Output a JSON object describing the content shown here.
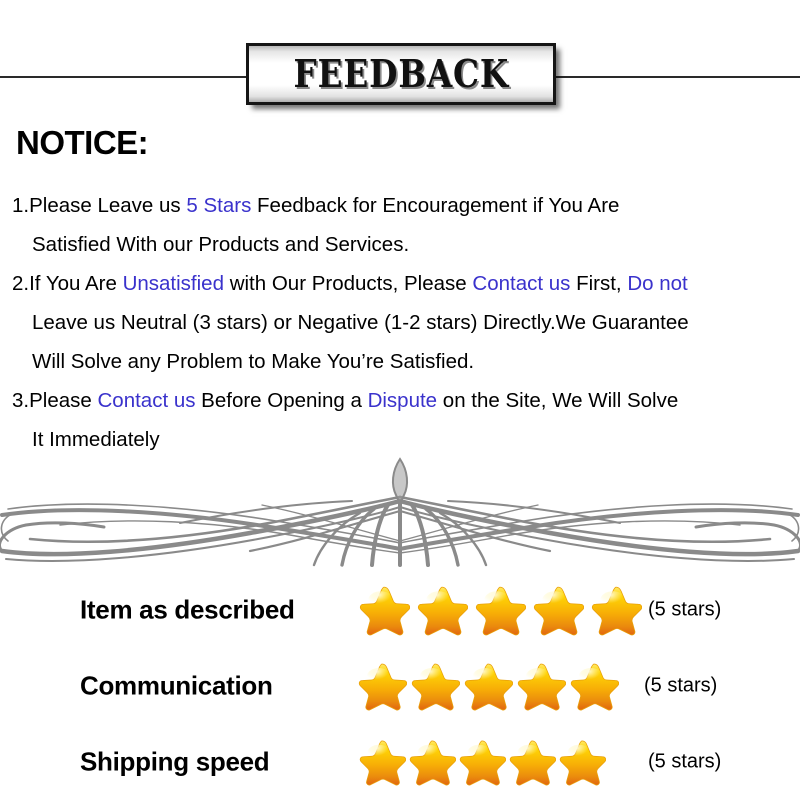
{
  "banner": {
    "title": "FEEDBACK"
  },
  "notice": {
    "heading": "NOTICE:",
    "items": [
      {
        "lines": [
          [
            {
              "t": "1.Please Leave us  ",
              "hl": false
            },
            {
              "t": "5 Stars",
              "hl": true
            },
            {
              "t": "  Feedback for  Encouragement  if You Are",
              "hl": false
            }
          ],
          [
            {
              "t": "Satisfied With our Products and Services.",
              "hl": false
            }
          ]
        ]
      },
      {
        "lines": [
          [
            {
              "t": "2.If You Are ",
              "hl": false
            },
            {
              "t": "Unsatisfied",
              "hl": true
            },
            {
              "t": " with Our Products, Please ",
              "hl": false
            },
            {
              "t": "Contact us",
              "hl": true
            },
            {
              "t": " First, ",
              "hl": false
            },
            {
              "t": "Do not",
              "hl": true
            }
          ],
          [
            {
              "t": "Leave us Neutral (3 stars) or Negative (1-2 stars) Directly.We Guarantee",
              "hl": false
            }
          ],
          [
            {
              "t": "Will Solve any Problem to Make You’re  Satisfied.",
              "hl": false
            }
          ]
        ]
      },
      {
        "lines": [
          [
            {
              "t": "3.Please ",
              "hl": false
            },
            {
              "t": "Contact us",
              "hl": true
            },
            {
              "t": " Before Opening a ",
              "hl": false
            },
            {
              "t": "Dispute",
              "hl": true
            },
            {
              "t": " on the Site, We Will Solve",
              "hl": false
            }
          ],
          [
            {
              "t": "It Immediately",
              "hl": false
            }
          ]
        ]
      }
    ]
  },
  "ratings": {
    "rows": [
      {
        "label": "Item as described",
        "stars": 5,
        "count_label": "(5 stars)",
        "star_size": 52
      },
      {
        "label": "Communication",
        "stars": 5,
        "count_label": "(5 stars)",
        "star_size": 50
      },
      {
        "label": "Shipping speed",
        "stars": 5,
        "count_label": "(5 stars)",
        "star_size": 48
      }
    ]
  },
  "colors": {
    "highlight": "#3a32cc",
    "text": "#000000",
    "ornament": "#8a8a8a",
    "star_top": "#ffd90a",
    "star_mid": "#f5a60a",
    "star_bottom": "#e06a12",
    "banner_border": "#151515"
  }
}
